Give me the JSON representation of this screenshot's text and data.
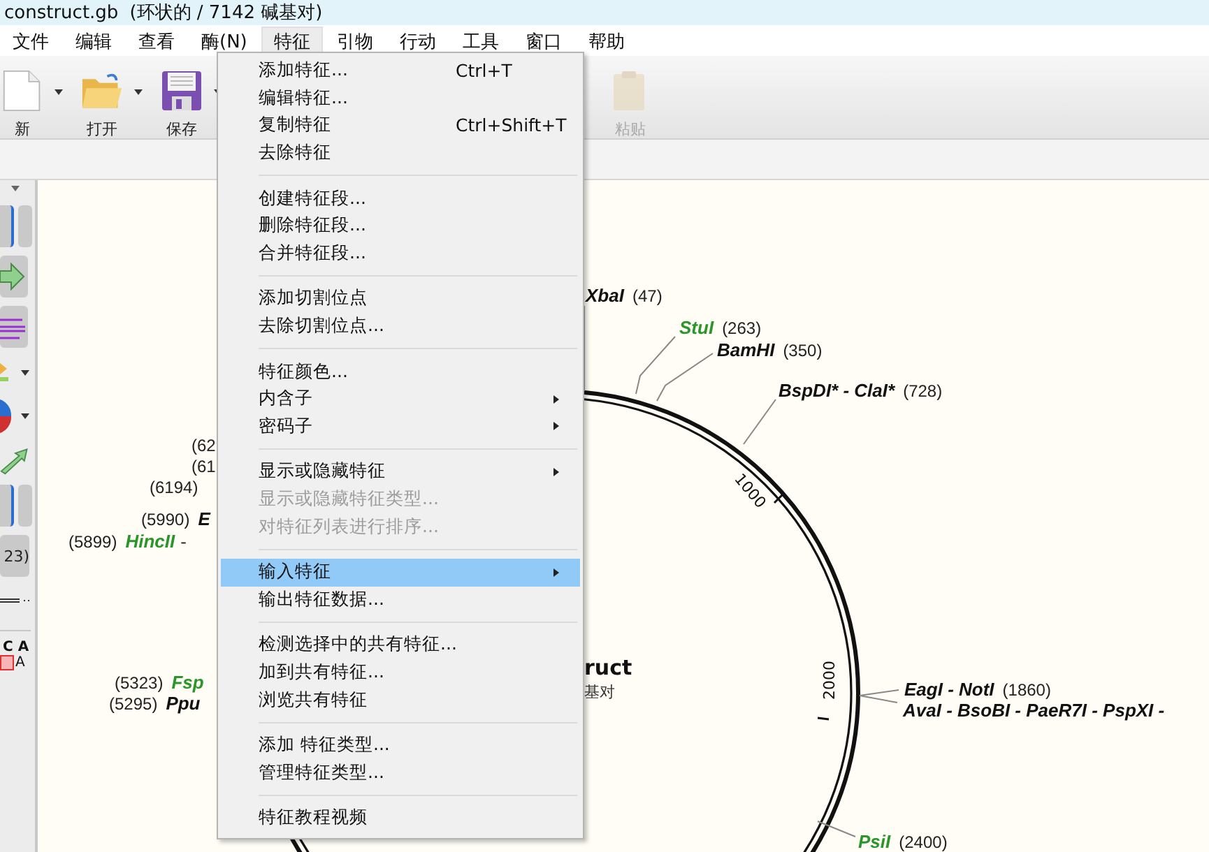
{
  "window": {
    "title": "construct.gb",
    "subtitle": "(环状的 / 7142 碱基对)"
  },
  "menu_bar": [
    {
      "label": "文件",
      "selected": false
    },
    {
      "label": "编辑",
      "selected": false
    },
    {
      "label": "查看",
      "selected": false
    },
    {
      "label": "酶(N)",
      "selected": false
    },
    {
      "label": "特征",
      "selected": true
    },
    {
      "label": "引物",
      "selected": false
    },
    {
      "label": "行动",
      "selected": false
    },
    {
      "label": "工具",
      "selected": false
    },
    {
      "label": "窗口",
      "selected": false
    },
    {
      "label": "帮助",
      "selected": false
    }
  ],
  "toolbar": [
    {
      "kind": "new",
      "label": "新",
      "dropdown": true,
      "disabled": false
    },
    {
      "kind": "open",
      "label": "打开",
      "dropdown": true,
      "disabled": false
    },
    {
      "kind": "save",
      "label": "保存",
      "dropdown": true,
      "disabled": false
    },
    {
      "kind": "paste",
      "label": "粘贴",
      "dropdown": false,
      "disabled": true
    }
  ],
  "left_panel": {
    "count_label": "23)",
    "sequence_top": "C A",
    "sequence_bottom": "A"
  },
  "map": {
    "name": "ruct",
    "subtitle": "基对",
    "tick_labels": [
      "1000",
      "2000"
    ],
    "labels": [
      {
        "kind": "name_first",
        "name": "XbaI",
        "position": "(47)",
        "color": "#111111"
      },
      {
        "kind": "name_first",
        "name": "StuI",
        "position": "(263)",
        "color": "#2a962a"
      },
      {
        "kind": "name_first",
        "name": "BamHI",
        "position": "(350)",
        "color": "#111111"
      },
      {
        "kind": "name_first",
        "name": "BspDI* - ClaI*",
        "position": "(728)",
        "color": "#111111"
      },
      {
        "kind": "name_first",
        "name": "EagI - NotI",
        "position": "(1860)",
        "color": "#111111"
      },
      {
        "kind": "name_first",
        "name": "AvaI - BsoBI - PaeR7I - PspXI -",
        "color": "#111111"
      },
      {
        "kind": "name_first",
        "name": "PsiI",
        "position": "(2400)",
        "color": "#2a962a"
      },
      {
        "kind": "position_first",
        "position": "(62"
      },
      {
        "kind": "position_first",
        "position": "(61"
      },
      {
        "kind": "position_first",
        "position": "(6194)"
      },
      {
        "kind": "position_first",
        "position": "(5990)",
        "name": "E",
        "color": "#111111"
      },
      {
        "kind": "position_first",
        "position": "(5899)",
        "name": "HincII",
        "suffix": "-",
        "color": "#2a962a"
      },
      {
        "kind": "position_first",
        "position": "(5323)",
        "name": "Fsp",
        "color": "#2a962a"
      },
      {
        "kind": "position_first",
        "position": "(5295)",
        "name": "Ppu",
        "color": "#111111"
      }
    ]
  },
  "feature_menu": {
    "groups": [
      [
        {
          "label": "添加特征...",
          "shortcut": "Ctrl+T",
          "submenu": false,
          "disabled": false,
          "selected": false
        },
        {
          "label": "编辑特征...",
          "submenu": false,
          "disabled": false,
          "selected": false
        },
        {
          "label": "复制特征",
          "shortcut": "Ctrl+Shift+T",
          "submenu": false,
          "disabled": false,
          "selected": false
        },
        {
          "label": "去除特征",
          "submenu": false,
          "disabled": false,
          "selected": false
        }
      ],
      [
        {
          "label": "创建特征段...",
          "submenu": false,
          "disabled": false,
          "selected": false
        },
        {
          "label": "删除特征段...",
          "submenu": false,
          "disabled": false,
          "selected": false
        },
        {
          "label": "合并特征段...",
          "submenu": false,
          "disabled": false,
          "selected": false
        }
      ],
      [
        {
          "label": "添加切割位点",
          "submenu": false,
          "disabled": false,
          "selected": false
        },
        {
          "label": "去除切割位点...",
          "submenu": false,
          "disabled": false,
          "selected": false
        }
      ],
      [
        {
          "label": "特征颜色...",
          "submenu": false,
          "disabled": false,
          "selected": false
        },
        {
          "label": "内含子",
          "submenu": true,
          "disabled": false,
          "selected": false
        },
        {
          "label": "密码子",
          "submenu": true,
          "disabled": false,
          "selected": false
        }
      ],
      [
        {
          "label": "显示或隐藏特征",
          "submenu": true,
          "disabled": false,
          "selected": false
        },
        {
          "label": "显示或隐藏特征类型...",
          "submenu": false,
          "disabled": true,
          "selected": false
        },
        {
          "label": "对特征列表进行排序...",
          "submenu": false,
          "disabled": true,
          "selected": false
        }
      ],
      [
        {
          "label": "输入特征",
          "submenu": true,
          "disabled": false,
          "selected": true
        },
        {
          "label": "输出特征数据...",
          "submenu": false,
          "disabled": false,
          "selected": false
        }
      ],
      [
        {
          "label": "检测选择中的共有特征...",
          "submenu": false,
          "disabled": false,
          "selected": false
        },
        {
          "label": "加到共有特征...",
          "submenu": false,
          "disabled": false,
          "selected": false
        },
        {
          "label": "浏览共有特征",
          "submenu": false,
          "disabled": false,
          "selected": false
        }
      ],
      [
        {
          "label": "添加 特征类型...",
          "submenu": false,
          "disabled": false,
          "selected": false
        },
        {
          "label": "管理特征类型...",
          "submenu": false,
          "disabled": false,
          "selected": false
        }
      ],
      [
        {
          "label": "特征教程视频",
          "submenu": false,
          "disabled": false,
          "selected": false
        }
      ]
    ]
  }
}
